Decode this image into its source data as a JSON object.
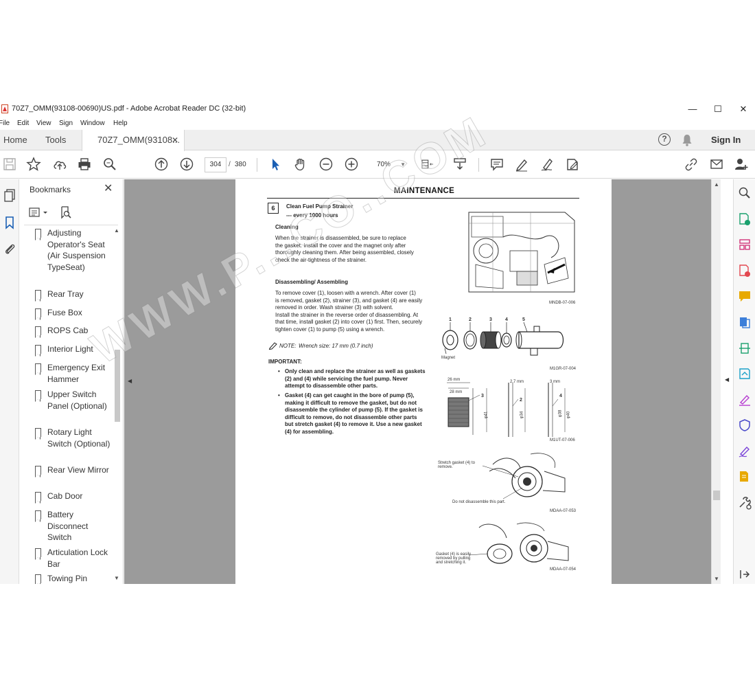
{
  "window": {
    "title": "70Z7_OMM(93108-00690)US.pdf - Adobe Acrobat Reader DC (32-bit)",
    "minimize": "—",
    "maximize": "☐",
    "close": "✕"
  },
  "menu": [
    "File",
    "Edit",
    "View",
    "Sign",
    "Window",
    "Help"
  ],
  "tabs": {
    "home": "Home",
    "tools": "Tools",
    "document": "70Z7_OMM(93108...",
    "document_close": "✕",
    "help": "?",
    "sign_in": "Sign In"
  },
  "toolbar": {
    "current_page": "304",
    "separator": "/",
    "total_pages": "380",
    "zoom": "70%"
  },
  "bookmarks": {
    "header": "Bookmarks",
    "close": "✕",
    "items": [
      "Adjusting Operator's Seat (Air Suspension TypeSeat)",
      "Rear Tray",
      "Fuse Box",
      "ROPS Cab",
      "Interior Light",
      "Emergency Exit Hammer",
      "Upper Switch Panel (Optional)",
      "Rotary Light Switch (Optional)",
      "Rear View Mirror",
      "Cab Door",
      "Battery Disconnect Switch",
      "Articulation Lock Bar",
      "Towing Pin"
    ]
  },
  "page": {
    "header": "MAINTENANCE",
    "section_number": "6",
    "section_title": "Clean Fuel Pump Strainer",
    "section_interval": "--- every 1000 hours",
    "cleaning_heading": "Cleaning",
    "cleaning_lines": [
      "When the strainer is disassembled, be sure to replace",
      "the gasket. Install the cover and the magnet only after",
      "thoroughly cleaning them. After being assembled, closely",
      "check the air-tightness of the strainer."
    ],
    "disassembling_heading": "Disassembling/ Assembling",
    "disassembling_lines": [
      "To remove cover (1), loosen with a wrench. After cover (1)",
      "is removed, gasket (2), strainer (3), and gasket (4) are easily",
      "removed in order. Wash strainer (3) with solvent.",
      "Install the strainer in the reverse order of disassembling. At",
      "that time, install gasket (2) into cover (1) first. Then, securely",
      "tighten cover (1) to pump (5) using a wrench."
    ],
    "note_label": "NOTE:",
    "note_text": "Wrench size: 17 mm (0.7 inch)",
    "important_heading": "IMPORTANT:",
    "important_1": [
      "Only clean and replace the strainer as well as gaskets",
      "(2) and (4) while servicing the fuel pump. Never",
      "attempt to disassemble other parts."
    ],
    "important_2": [
      "Gasket (4) can get caught in the bore of pump (5),",
      "making it  difficult to remove the gasket, but do not",
      "disassemble the cylinder of pump (5). If the gasket is",
      "difficult to remove, do not disassemble other parts",
      "but stretch gasket (4) to remove it. Use a new gasket",
      "(4) for assembling."
    ],
    "fig1_code": "MNDB-07-006",
    "fig2_code": "M1GR-07-004",
    "fig2_magnet": "Magnet",
    "fig2_numbers": [
      "1",
      "2",
      "3",
      "4",
      "5"
    ],
    "fig3_code": "M1UT-07-006",
    "fig3_dims": [
      "26 mm",
      "28 mm",
      "2.7 mm",
      "3 mm",
      "φ41",
      "φ34",
      "φ38",
      "φ40"
    ],
    "fig3_numbers": [
      "3",
      "2",
      "4"
    ],
    "fig4_code": "MDAA-07-053",
    "fig4_note1": "Stretch gasket (4) to remove.",
    "fig4_note2": "Do not disassemble this part.",
    "fig5_code": "MDAA-07-054",
    "fig5_note": "Gasket (4) is easily removed by pulling and stretching it."
  },
  "watermark": "WWW.P...CO..COM"
}
